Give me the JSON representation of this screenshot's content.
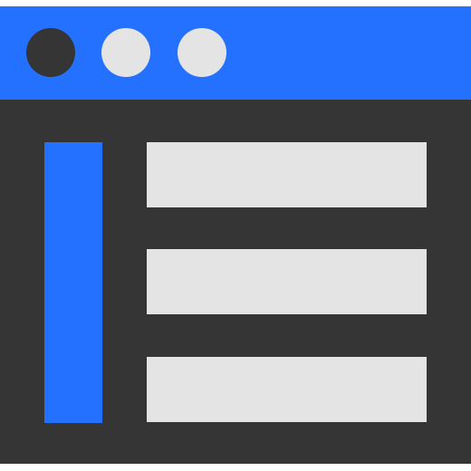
{
  "window": {
    "titlebar": {
      "buttons": [
        {
          "id": "first",
          "color": "#353535"
        },
        {
          "id": "second",
          "color": "#e4e4e4"
        },
        {
          "id": "third",
          "color": "#e4e4e4"
        }
      ],
      "accent_color": "#2470ff"
    },
    "body": {
      "background_color": "#353535",
      "sidebar": {
        "color": "#2470ff"
      },
      "rows": [
        {
          "id": "row-1",
          "color": "#e4e4e4"
        },
        {
          "id": "row-2",
          "color": "#e4e4e4"
        },
        {
          "id": "row-3",
          "color": "#e4e4e4"
        }
      ]
    }
  }
}
